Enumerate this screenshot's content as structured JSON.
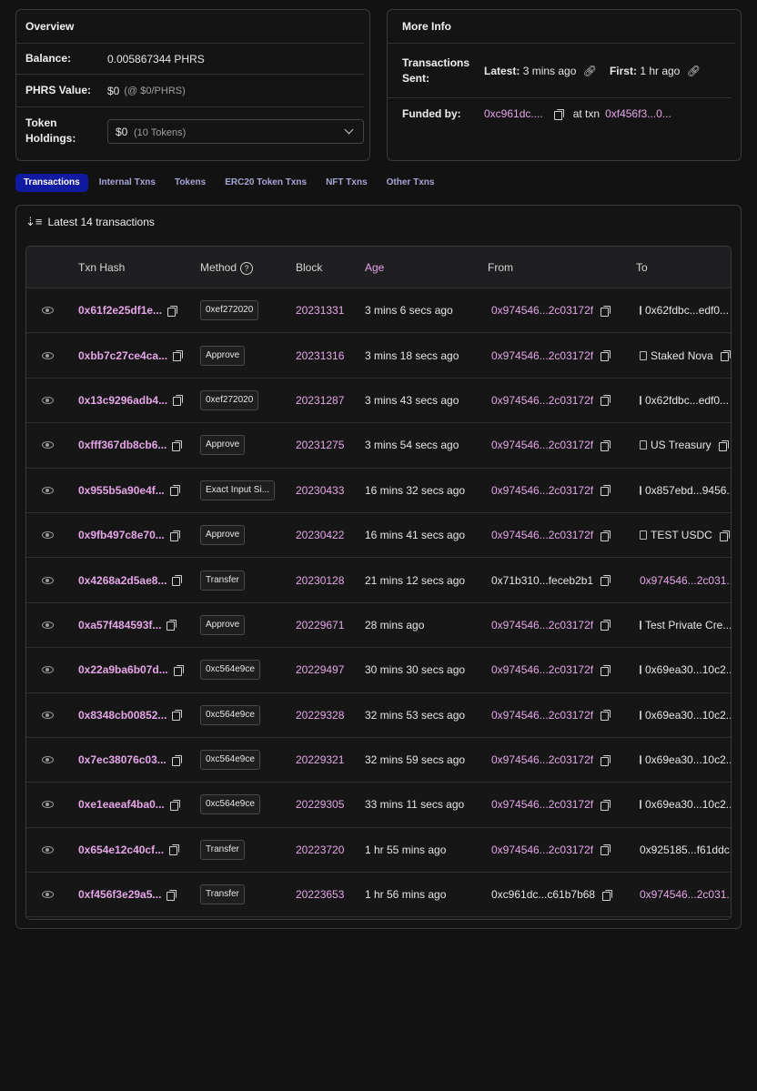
{
  "overview": {
    "title": "Overview",
    "balance_label": "Balance:",
    "balance_value": "0.005867344 PHRS",
    "value_label": "PHRS Value:",
    "value_value": "$0",
    "value_rate": "(@ $0/PHRS)",
    "holdings_label": "Token Holdings:",
    "holdings_value": "$0",
    "holdings_count": "(10 Tokens)"
  },
  "more_info": {
    "title": "More Info",
    "txs_sent_label": "Transactions Sent:",
    "latest_label": "Latest:",
    "latest_value": "3 mins ago",
    "first_label": "First:",
    "first_value": "1 hr ago",
    "funded_label": "Funded by:",
    "funded_address": "0xc961dc....",
    "at_txn_label": "at txn",
    "funded_txn": "0xf456f3...0..."
  },
  "tabs": [
    {
      "label": "Transactions",
      "active": true
    },
    {
      "label": "Internal Txns",
      "active": false
    },
    {
      "label": "Tokens",
      "active": false
    },
    {
      "label": "ERC20 Token Txns",
      "active": false
    },
    {
      "label": "NFT Txns",
      "active": false
    },
    {
      "label": "Other Txns",
      "active": false
    }
  ],
  "table": {
    "summary": "Latest 14 transactions",
    "headers": {
      "hash": "Txn Hash",
      "method": "Method",
      "block": "Block",
      "age": "Age",
      "from": "From",
      "to": "To"
    },
    "rows": [
      {
        "hash": "0x61f2e25df1e...",
        "method": "0xef272020",
        "block": "20231331",
        "age": "3 mins 6 secs ago",
        "from": "0x974546...2c03172f",
        "from_pink": true,
        "to": "0x62fdbc...edf0...",
        "to_contract": true,
        "to_pink": false
      },
      {
        "hash": "0xbb7c27ce4ca...",
        "method": "Approve",
        "block": "20231316",
        "age": "3 mins 18 secs ago",
        "from": "0x974546...2c03172f",
        "from_pink": true,
        "to": "Staked Nova",
        "to_contract": true,
        "to_pink": false
      },
      {
        "hash": "0x13c9296adb4...",
        "method": "0xef272020",
        "block": "20231287",
        "age": "3 mins 43 secs ago",
        "from": "0x974546...2c03172f",
        "from_pink": true,
        "to": "0x62fdbc...edf0...",
        "to_contract": true,
        "to_pink": false
      },
      {
        "hash": "0xfff367db8cb6...",
        "method": "Approve",
        "block": "20231275",
        "age": "3 mins 54 secs ago",
        "from": "0x974546...2c03172f",
        "from_pink": true,
        "to": "US Treasury",
        "to_contract": true,
        "to_pink": false
      },
      {
        "hash": "0x955b5a90e4f...",
        "method": "Exact Input Si...",
        "block": "20230433",
        "age": "16 mins 32 secs ago",
        "from": "0x974546...2c03172f",
        "from_pink": true,
        "to": "0x857ebd...9456...",
        "to_contract": true,
        "to_pink": false
      },
      {
        "hash": "0x9fb497c8e70...",
        "method": "Approve",
        "block": "20230422",
        "age": "16 mins 41 secs ago",
        "from": "0x974546...2c03172f",
        "from_pink": true,
        "to": "TEST USDC",
        "to_contract": true,
        "to_pink": false
      },
      {
        "hash": "0x4268a2d5ae8...",
        "method": "Transfer",
        "block": "20230128",
        "age": "21 mins 12 secs ago",
        "from": "0x71b310...feceb2b1",
        "from_pink": false,
        "to": "0x974546...2c031...",
        "to_contract": false,
        "to_pink": true
      },
      {
        "hash": "0xa57f484593f...",
        "method": "Approve",
        "block": "20229671",
        "age": "28 mins ago",
        "from": "0x974546...2c03172f",
        "from_pink": true,
        "to": "Test Private Cre...",
        "to_contract": true,
        "to_pink": false
      },
      {
        "hash": "0x22a9ba6b07d...",
        "method": "0xc564e9ce",
        "block": "20229497",
        "age": "30 mins 30 secs ago",
        "from": "0x974546...2c03172f",
        "from_pink": true,
        "to": "0x69ea30...10c2...",
        "to_contract": true,
        "to_pink": false
      },
      {
        "hash": "0x8348cb00852...",
        "method": "0xc564e9ce",
        "block": "20229328",
        "age": "32 mins 53 secs ago",
        "from": "0x974546...2c03172f",
        "from_pink": true,
        "to": "0x69ea30...10c2...",
        "to_contract": true,
        "to_pink": false
      },
      {
        "hash": "0x7ec38076c03...",
        "method": "0xc564e9ce",
        "block": "20229321",
        "age": "32 mins 59 secs ago",
        "from": "0x974546...2c03172f",
        "from_pink": true,
        "to": "0x69ea30...10c2...",
        "to_contract": true,
        "to_pink": false
      },
      {
        "hash": "0xe1eaeaf4ba0...",
        "method": "0xc564e9ce",
        "block": "20229305",
        "age": "33 mins 11 secs ago",
        "from": "0x974546...2c03172f",
        "from_pink": true,
        "to": "0x69ea30...10c2...",
        "to_contract": true,
        "to_pink": false
      },
      {
        "hash": "0x654e12c40cf...",
        "method": "Transfer",
        "block": "20223720",
        "age": "1 hr 55 mins ago",
        "from": "0x974546...2c03172f",
        "from_pink": true,
        "to": "0x925185...f61ddc...",
        "to_contract": false,
        "to_pink": false
      },
      {
        "hash": "0xf456f3e29a5...",
        "method": "Transfer",
        "block": "20223653",
        "age": "1 hr 56 mins ago",
        "from": "0xc961dc...c61b7b68",
        "from_pink": false,
        "to": "0x974546...2c031...",
        "to_contract": false,
        "to_pink": true
      }
    ]
  }
}
